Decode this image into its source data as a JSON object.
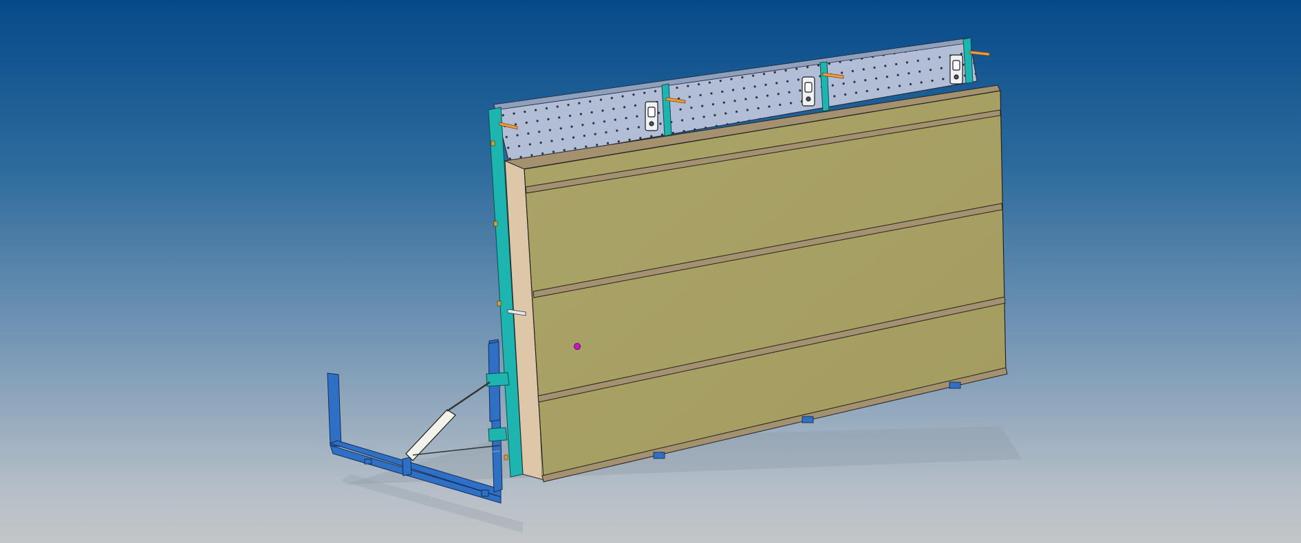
{
  "viewport": {
    "background_top": "#064a8a",
    "background_bottom": "#c3c6c9"
  },
  "model": {
    "perforated_panel_color": "#b2bed6",
    "frame_post_color": "#1eb5b0",
    "board_face_color": "#a7a062",
    "board_edge_color": "#dcc8a8",
    "slat_color": "#a39170",
    "base_frame_color": "#2f6fc4",
    "pin_color": "#f09a3e",
    "marker_color": "#cc18c4",
    "clamp_icon": "latch-clamp-icon",
    "marker_icon": "selection-point-icon"
  }
}
